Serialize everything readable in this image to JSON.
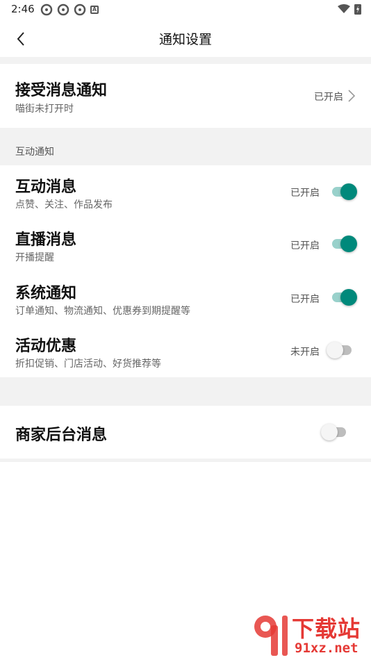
{
  "status_bar": {
    "time": "2:46",
    "a_label": "A"
  },
  "header": {
    "title": "通知设置"
  },
  "receive": {
    "title": "接受消息通知",
    "subtitle": "喵街未打开时",
    "status": "已开启"
  },
  "interaction": {
    "section_label": "互动通知",
    "items": [
      {
        "title": "互动消息",
        "subtitle": "点赞、关注、作品发布",
        "status": "已开启",
        "on": true
      },
      {
        "title": "直播消息",
        "subtitle": "开播提醒",
        "status": "已开启",
        "on": true
      },
      {
        "title": "系统通知",
        "subtitle": "订单通知、物流通知、优惠券到期提醒等",
        "status": "已开启",
        "on": true
      },
      {
        "title": "活动优惠",
        "subtitle": "折扣促销、门店活动、好货推荐等",
        "status": "未开启",
        "on": false
      }
    ]
  },
  "merchant": {
    "title": "商家后台消息",
    "on": false
  },
  "watermark": {
    "name": "下载站",
    "url": "91xz.net"
  },
  "colors": {
    "accent": "#00897b",
    "accent_light": "#99d1cb",
    "gap": "#f2f2f2"
  }
}
